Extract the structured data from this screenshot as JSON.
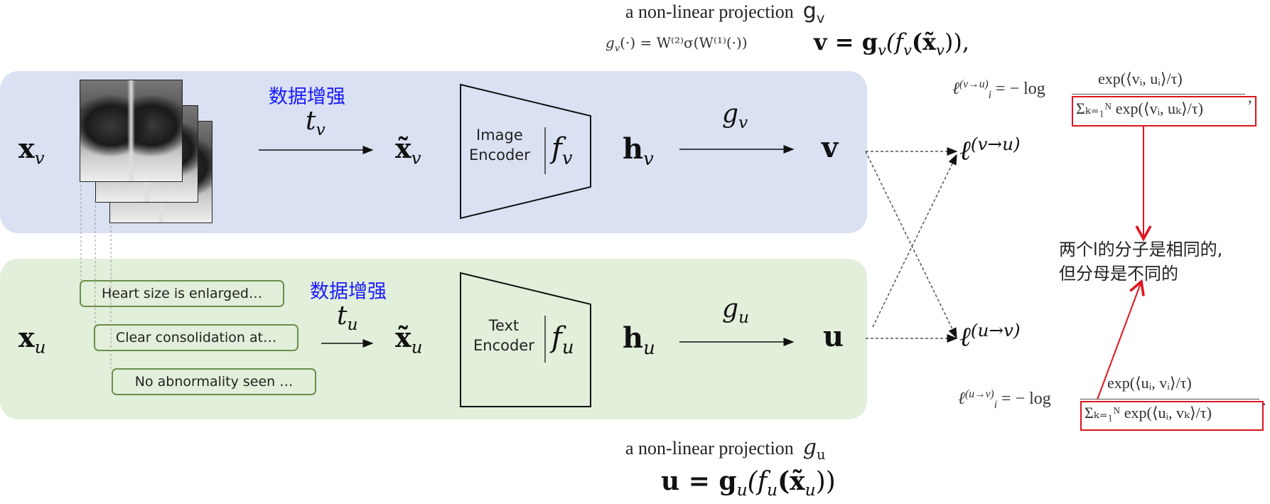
{
  "top_annotation": {
    "caption": "a non-linear projection",
    "caption_symbol": "g",
    "caption_symbol_sub": "v",
    "def_lhs": "g",
    "def_lhs_sub": "v",
    "def_rhs": "(·) = W⁽²⁾σ(W⁽¹⁾(·))",
    "v_eq": "v = g",
    "v_eq_sub": "v",
    "v_eq_rest": "(f",
    "v_eq_rest_sub": "v",
    "v_eq_tail": "(x̃",
    "v_eq_tail_sub": "v",
    "v_eq_end": ")),"
  },
  "image_branch": {
    "input_symbol": "x",
    "input_sub": "v",
    "augment_label": "数据增强",
    "transform": "t",
    "transform_sub": "v",
    "augmented": "x̃",
    "augmented_sub": "v",
    "encoder_line1": "Image",
    "encoder_line2": "Encoder",
    "encoder_fn": "f",
    "encoder_fn_sub": "v",
    "hidden": "h",
    "hidden_sub": "v",
    "projection": "g",
    "projection_sub": "v",
    "output": "v"
  },
  "text_branch": {
    "input_symbol": "x",
    "input_sub": "u",
    "augment_label": "数据增强",
    "transform": "t",
    "transform_sub": "u",
    "augmented": "x̃",
    "augmented_sub": "u",
    "encoder_line1": "Text",
    "encoder_line2": "Encoder",
    "encoder_fn": "f",
    "encoder_fn_sub": "u",
    "hidden": "h",
    "hidden_sub": "u",
    "projection": "g",
    "projection_sub": "u",
    "output": "u",
    "reports": [
      "Heart size is enlarged…",
      "Clear consolidation at…",
      "No abnormality seen …"
    ]
  },
  "losses": {
    "v_to_u": "ℓ",
    "v_to_u_sup": "(v→u)",
    "u_to_v": "ℓ",
    "u_to_v_sup": "(u→v)"
  },
  "loss_formulas": {
    "vu_lhs": "ℓ",
    "vu_lhs_sup": "(v→u)",
    "vu_lhs_sub": "i",
    "vu_eq": "= − log",
    "vu_num": "exp(⟨vᵢ, uᵢ⟩/τ)",
    "vu_den": "Σₖ₌₁ᴺ exp(⟨vᵢ, uₖ⟩/τ)",
    "vu_trail": ",",
    "uv_lhs": "ℓ",
    "uv_lhs_sup": "(u→v)",
    "uv_lhs_sub": "i",
    "uv_eq": "= − log",
    "uv_num": "exp(⟨uᵢ, vᵢ⟩/τ)",
    "uv_den": "Σₖ₌₁ᴺ exp(⟨uᵢ, vₖ⟩/τ)",
    "uv_trail": "."
  },
  "note": {
    "line1": "两个l的分子是相同的,",
    "line2": "但分母是不同的"
  },
  "bottom_annotation": {
    "caption": "a non-linear projection",
    "caption_symbol": "g",
    "caption_symbol_sub": "u",
    "u_eq": "u = g",
    "u_eq_sub": "u",
    "u_eq_rest": "(f",
    "u_eq_rest_sub": "u",
    "u_eq_tail": "(x̃",
    "u_eq_tail_sub": "u",
    "u_eq_end": "))"
  },
  "colors": {
    "image_panel": "#d9e1f2",
    "text_panel": "#e2efda",
    "report_border": "#6b8f4a",
    "augment_label": "#1a1aff",
    "highlight": "#e0141e"
  }
}
